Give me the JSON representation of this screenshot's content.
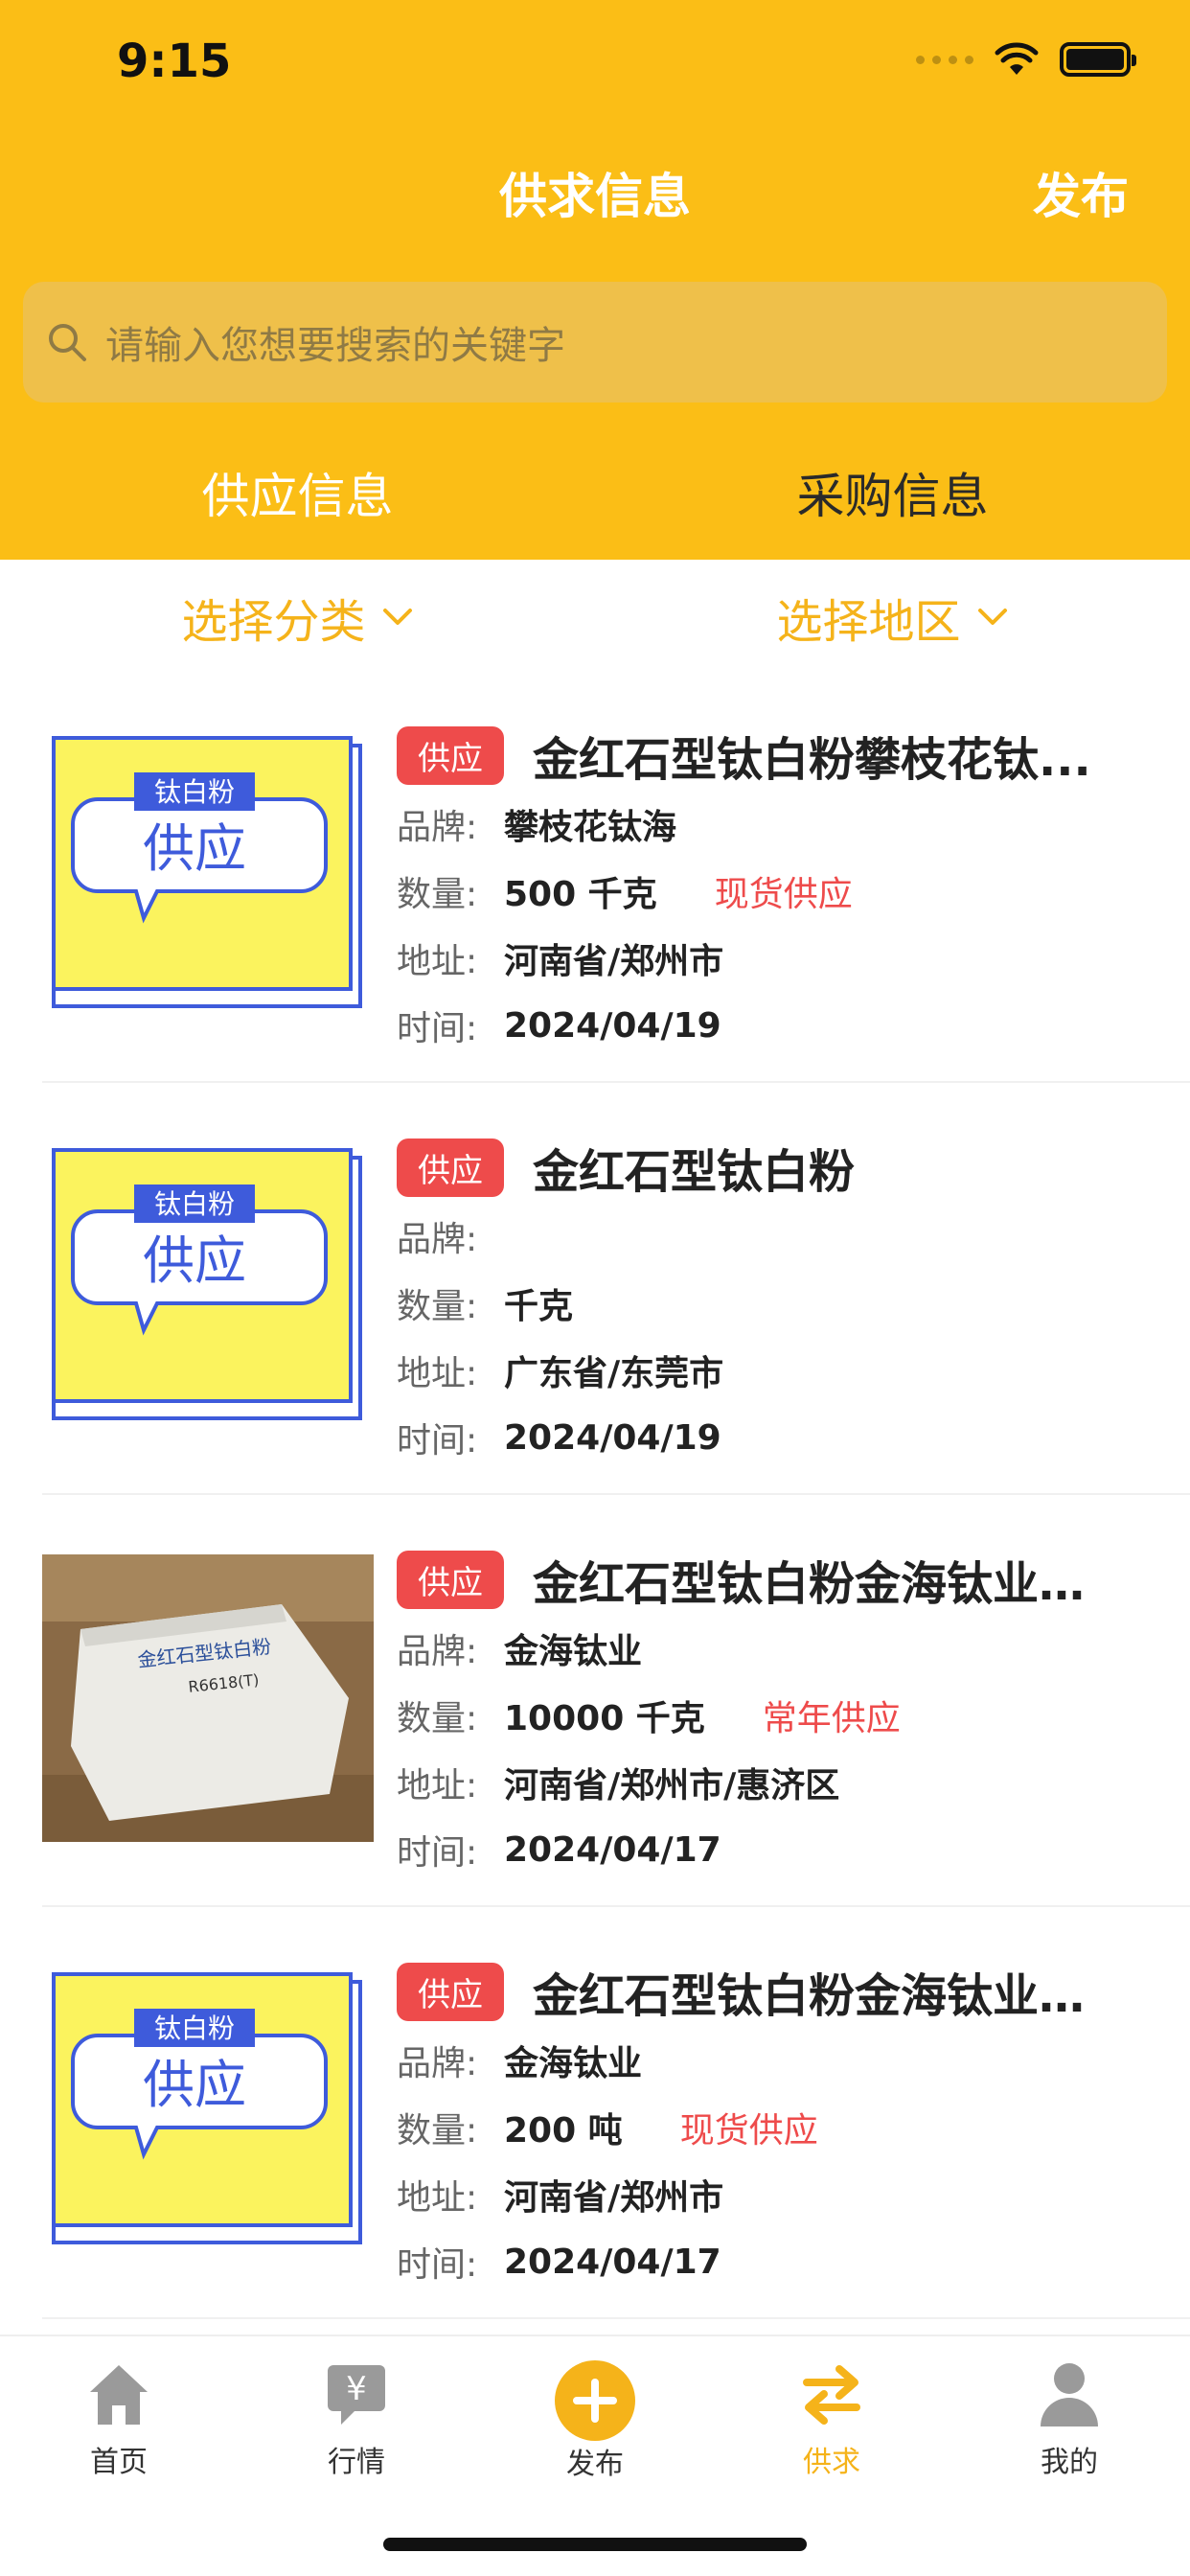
{
  "status_bar": {
    "time": "9:15"
  },
  "nav": {
    "title": "供求信息",
    "action": "发布"
  },
  "search": {
    "placeholder": "请输入您想要搜索的关键字"
  },
  "tabs": [
    {
      "label": "供应信息",
      "active": true
    },
    {
      "label": "采购信息",
      "active": false
    }
  ],
  "filters": [
    {
      "label": "选择分类"
    },
    {
      "label": "选择地区"
    }
  ],
  "placeholder_image": {
    "top_label": "钛白粉",
    "main_label": "供应"
  },
  "photo_text": {
    "brand": "金红石型钛白粉",
    "code": "R6618(T)"
  },
  "list": [
    {
      "badge": "供应",
      "title": "金红石型钛白粉攀枝花钛...",
      "brand_label": "品牌:",
      "brand": "攀枝花钛海",
      "qty_label": "数量:",
      "qty": "500 千克",
      "tag": "现货供应",
      "addr_label": "地址:",
      "addr": "河南省/郑州市",
      "time_label": "时间:",
      "time": "2024/04/19"
    },
    {
      "badge": "供应",
      "title": "金红石型钛白粉",
      "brand_label": "品牌:",
      "brand": "",
      "qty_label": "数量:",
      "qty": " 千克",
      "tag": "",
      "addr_label": "地址:",
      "addr": "广东省/东莞市",
      "time_label": "时间:",
      "time": "2024/04/19"
    },
    {
      "badge": "供应",
      "title": "金红石型钛白粉金海钛业R...",
      "brand_label": "品牌:",
      "brand": "金海钛业",
      "qty_label": "数量:",
      "qty": "10000 千克",
      "tag": "常年供应",
      "addr_label": "地址:",
      "addr": "河南省/郑州市/惠济区",
      "time_label": "时间:",
      "time": "2024/04/17"
    },
    {
      "badge": "供应",
      "title": "金红石型钛白粉金海钛业R...",
      "brand_label": "品牌:",
      "brand": "金海钛业",
      "qty_label": "数量:",
      "qty": "200 吨",
      "tag": "现货供应",
      "addr_label": "地址:",
      "addr": "河南省/郑州市",
      "time_label": "时间:",
      "time": "2024/04/17"
    }
  ],
  "tabbar": [
    {
      "label": "首页",
      "icon": "home-icon"
    },
    {
      "label": "行情",
      "icon": "yen-chat-icon"
    },
    {
      "label": "发布",
      "icon": "plus-circle-icon"
    },
    {
      "label": "供求",
      "icon": "swap-icon",
      "active": true
    },
    {
      "label": "我的",
      "icon": "user-icon"
    }
  ],
  "colors": {
    "primary": "#FBBE16",
    "accent": "#F5B31A",
    "badge": "#EE4B4B"
  }
}
